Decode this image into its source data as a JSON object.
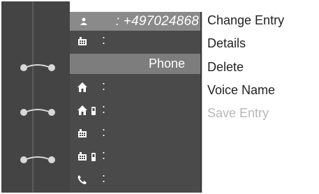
{
  "header": {
    "person_icon": "person-icon",
    "number": ": +497024868"
  },
  "entries": [
    {
      "icon": "office-building-icon",
      "label": ":"
    },
    {
      "icon": "none",
      "label": "Phone",
      "selected": true
    },
    {
      "icon": "home-icon",
      "label": ":"
    },
    {
      "icon": "home-mobile-icon",
      "label": ":"
    },
    {
      "icon": "office-building-icon",
      "label": ":"
    },
    {
      "icon": "office-mobile-icon",
      "label": ":"
    },
    {
      "icon": "phone-handset-icon",
      "label": ":"
    }
  ],
  "menu": {
    "items": [
      {
        "label": "Change Entry",
        "enabled": true
      },
      {
        "label": "Details",
        "enabled": true
      },
      {
        "label": "Delete",
        "enabled": true
      },
      {
        "label": "Voice Name",
        "enabled": true
      },
      {
        "label": "Save Entry",
        "enabled": false
      }
    ]
  },
  "colors": {
    "list_background": "#4a4a4a",
    "selected_row": "#7d7d7d",
    "header_background": "#8a8a8a",
    "disabled_text": "#b7b7b7"
  }
}
